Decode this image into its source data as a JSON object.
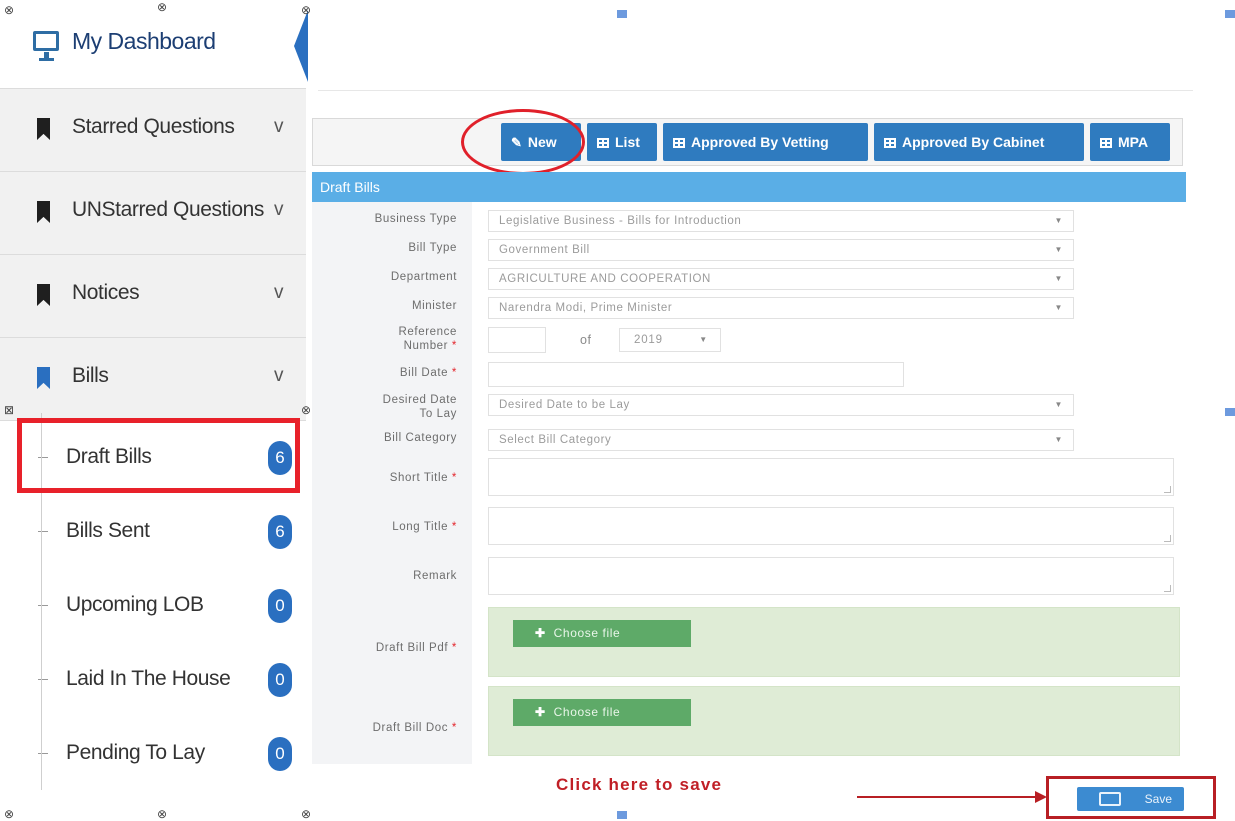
{
  "sidebar": {
    "dashboard_label": "My Dashboard",
    "items": [
      {
        "label": "Starred Questions",
        "chevron": "v"
      },
      {
        "label": "UNStarred Questions",
        "chevron": "v"
      },
      {
        "label": "Notices",
        "chevron": "v"
      },
      {
        "label": "Bills",
        "chevron": "v"
      }
    ],
    "sub_items": [
      {
        "label": "Draft Bills",
        "count": "6"
      },
      {
        "label": "Bills Sent",
        "count": "6"
      },
      {
        "label": "Upcoming LOB",
        "count": "0"
      },
      {
        "label": "Laid In The House",
        "count": "0"
      },
      {
        "label": "Pending To Lay",
        "count": "0"
      }
    ]
  },
  "toolbar": {
    "new_label": "New",
    "list_label": "List",
    "vetting_label": "Approved By Vetting",
    "cabinet_label": "Approved By Cabinet",
    "mpa_label": "MPA"
  },
  "form": {
    "panel_title": "Draft Bills",
    "business_type_label": "Business Type",
    "business_type_value": "Legislative Business - Bills for Introduction",
    "bill_type_label": "Bill Type",
    "bill_type_value": "Government Bill",
    "department_label": "Department",
    "department_value": "AGRICULTURE AND COOPERATION",
    "minister_label": "Minister",
    "minister_value": "Narendra Modi, Prime Minister",
    "reference_label_1": "Reference",
    "reference_label_2": "Number",
    "reference_of": "of",
    "reference_year": "2019",
    "bill_date_label": "Bill Date",
    "desired_date_label_1": "Desired Date",
    "desired_date_label_2": "To Lay",
    "desired_date_placeholder": "Desired Date to be Lay",
    "bill_category_label": "Bill Category",
    "bill_category_placeholder": "Select Bill Category",
    "short_title_label": "Short Title",
    "long_title_label": "Long Title",
    "remark_label": "Remark",
    "draft_pdf_label": "Draft Bill Pdf",
    "draft_doc_label": "Draft Bill Doc",
    "choose_file_label": "Choose file",
    "required_mark": "*",
    "caret": "▼"
  },
  "annotations": {
    "click_text": "Click here to save",
    "save_label": "Save"
  },
  "colors": {
    "primary": "#2f7bbf",
    "panel_header": "#5aaee6",
    "highlight_red": "#e8212a",
    "file_green": "#5eaa68"
  }
}
